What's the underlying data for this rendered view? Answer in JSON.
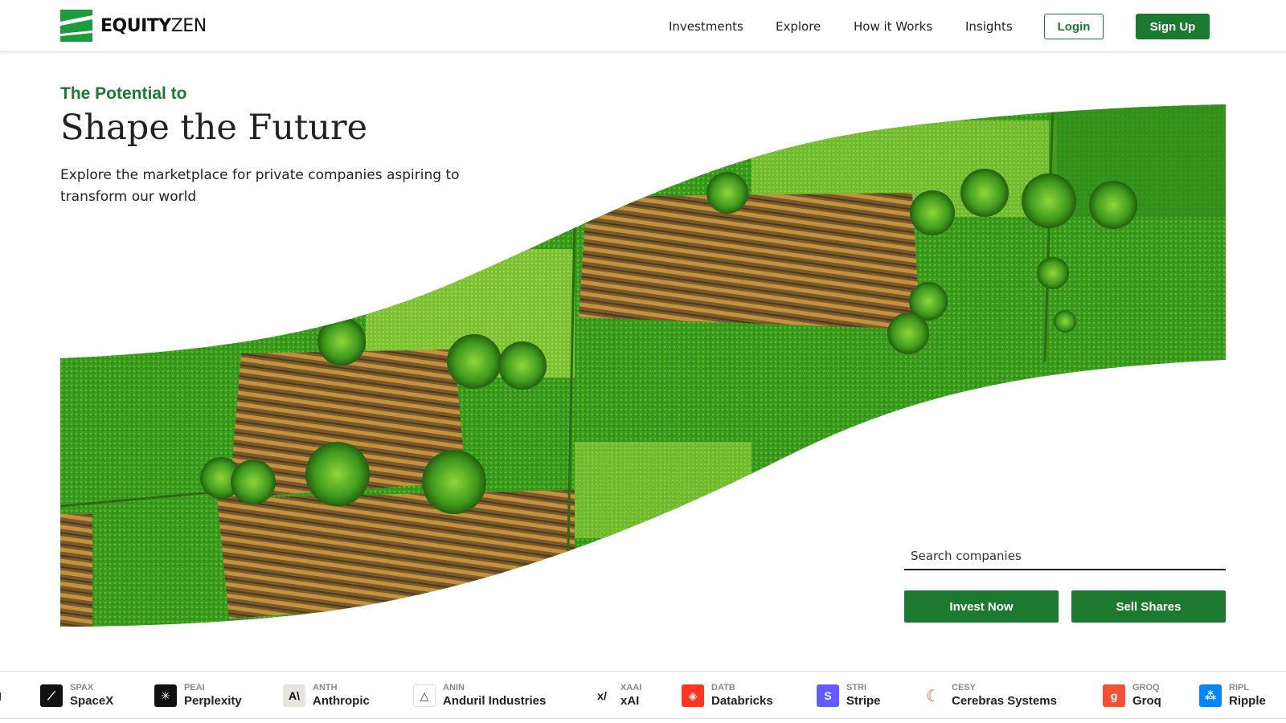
{
  "brand": {
    "name_bold": "EQUITY",
    "name_light": "ZEN",
    "color": "#1c7a30"
  },
  "nav": {
    "items": [
      "Investments",
      "Explore",
      "How it Works",
      "Insights"
    ],
    "login_label": "Login",
    "signup_label": "Sign Up"
  },
  "hero": {
    "eyebrow": "The Potential to",
    "headline": "Shape the Future",
    "subhead": "Explore the marketplace for private companies aspiring to transform our world"
  },
  "search": {
    "placeholder": "Search companies",
    "value": ""
  },
  "actions": {
    "invest_label": "Invest Now",
    "sell_label": "Sell Shares"
  },
  "ticker": [
    {
      "symbol": "SPAX",
      "name": "SpaceX",
      "icon": "spacex-icon",
      "color": "#111111"
    },
    {
      "symbol": "PEAI",
      "name": "Perplexity",
      "icon": "perplexity-icon",
      "color": "#111111"
    },
    {
      "symbol": "ANTH",
      "name": "Anthropic",
      "icon": "anthropic-icon",
      "color": "#e8e6dc"
    },
    {
      "symbol": "ANIN",
      "name": "Anduril Industries",
      "icon": "anduril-icon",
      "color": "#ffffff"
    },
    {
      "symbol": "XAAI",
      "name": "xAI",
      "icon": "xai-icon",
      "color": "#ffffff"
    },
    {
      "symbol": "DATB",
      "name": "Databricks",
      "icon": "databricks-icon",
      "color": "#ff3621"
    },
    {
      "symbol": "STRI",
      "name": "Stripe",
      "icon": "stripe-icon",
      "color": "#635bff"
    },
    {
      "symbol": "CESY",
      "name": "Cerebras Systems",
      "icon": "cerebras-icon",
      "color": "#ffffff"
    },
    {
      "symbol": "GROQ",
      "name": "Groq",
      "icon": "groq-icon",
      "color": "#f55036"
    },
    {
      "symbol": "RIPL",
      "name": "Ripple",
      "icon": "ripple-icon",
      "color": "#0085ff"
    }
  ]
}
